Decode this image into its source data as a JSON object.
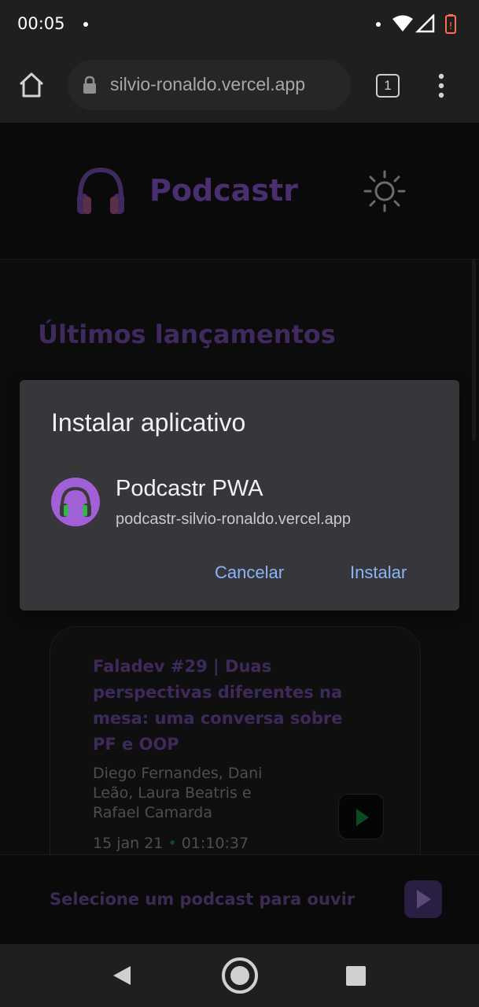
{
  "status_bar": {
    "time": "00:05"
  },
  "browser": {
    "url": "silvio-ronaldo.vercel.app",
    "tab_count": "1"
  },
  "site": {
    "brand": "Podcastr",
    "section_title": "Últimos lançamentos",
    "episode": {
      "title": "Faladev #29 | Duas perspectivas diferentes na mesa: uma conversa sobre PF e OOP",
      "members": "Diego Fernandes, Dani Leão, Laura Beatris e Rafael Camarda",
      "date": "15 jan 21",
      "separator": "•",
      "duration": "01:10:37"
    },
    "player": {
      "empty_text": "Selecione um podcast para ouvir"
    }
  },
  "dialog": {
    "title": "Instalar aplicativo",
    "app_name": "Podcastr PWA",
    "app_url": "podcastr-silvio-ronaldo.vercel.app",
    "cancel_label": "Cancelar",
    "install_label": "Instalar"
  },
  "colors": {
    "accent": "#8ab4f8",
    "app_icon_bg": "#a15fd8",
    "brand_purple": "#4a2f70"
  }
}
